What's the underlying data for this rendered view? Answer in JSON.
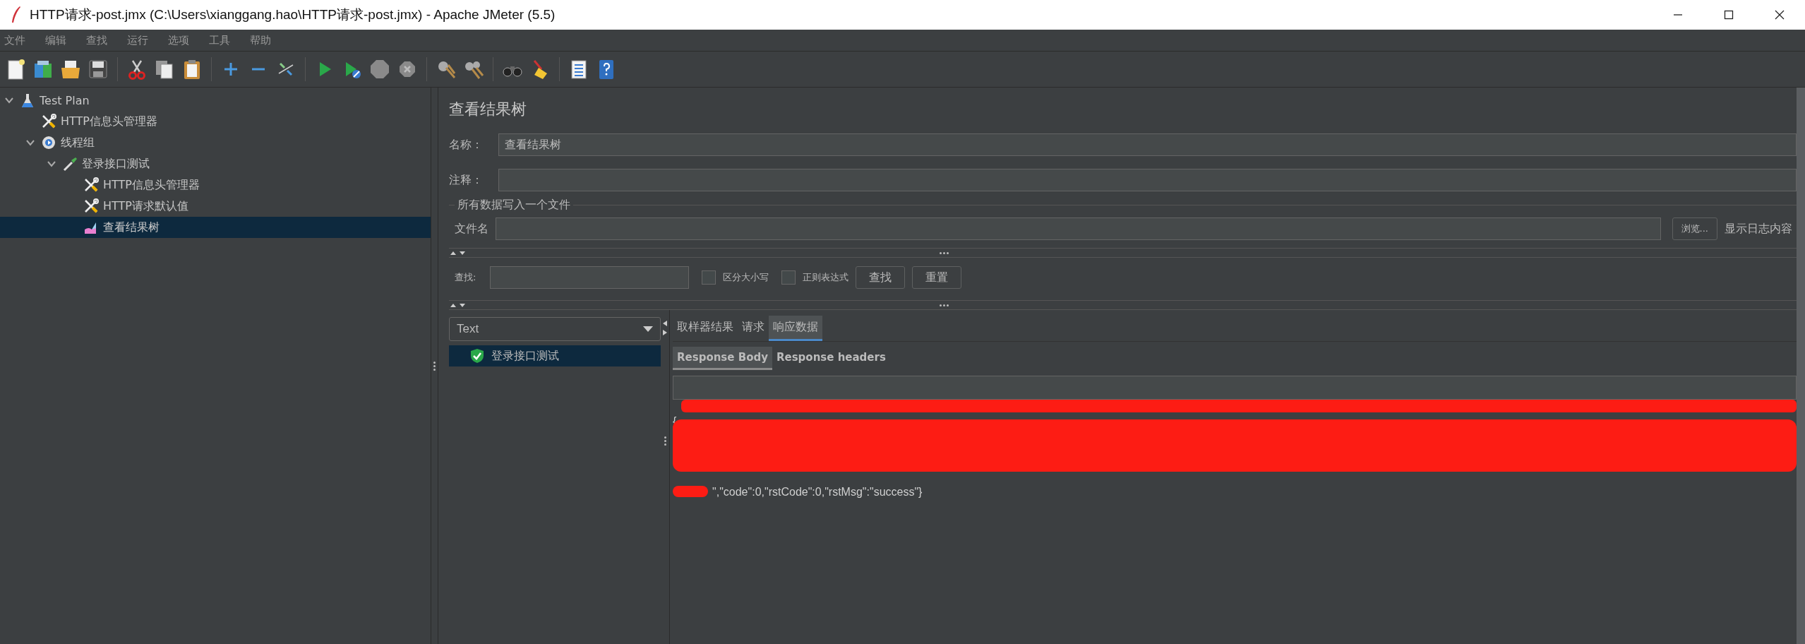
{
  "window": {
    "title": "HTTP请求-post.jmx (C:\\Users\\xianggang.hao\\HTTP请求-post.jmx) - Apache JMeter (5.5)"
  },
  "menu": [
    "文件",
    "编辑",
    "查找",
    "运行",
    "选项",
    "工具",
    "帮助"
  ],
  "tree": [
    {
      "label": "Test Plan",
      "kind": "plan",
      "expanded": true,
      "selected": false,
      "children": [
        {
          "label": "HTTP信息头管理器",
          "kind": "config",
          "selected": false
        },
        {
          "label": "线程组",
          "kind": "thread-group",
          "expanded": true,
          "selected": false,
          "children": [
            {
              "label": "登录接口测试",
              "kind": "sampler",
              "expanded": true,
              "selected": false,
              "children": [
                {
                  "label": "HTTP信息头管理器",
                  "kind": "config",
                  "selected": false
                },
                {
                  "label": "HTTP请求默认值",
                  "kind": "config",
                  "selected": false
                },
                {
                  "label": "查看结果树",
                  "kind": "listener",
                  "selected": true
                }
              ]
            }
          ]
        }
      ]
    }
  ],
  "panel": {
    "title": "查看结果树",
    "name_field": {
      "label": "名称：",
      "value": "查看结果树"
    },
    "comment_field": {
      "label": "注释："
    },
    "file_group": {
      "title": "所有数据写入一个文件",
      "label": "文件名",
      "browse_button": "浏览...",
      "log_label": "显示日志内容"
    },
    "search": {
      "label": "查找:",
      "options": [
        {
          "label": "区分大小写",
          "checked": false
        },
        {
          "label": "正则表达式",
          "checked": false
        }
      ],
      "buttons": [
        "查找",
        "重置"
      ]
    },
    "renderer": "Text",
    "results": [
      {
        "label": "登录接口测试",
        "kind": "success",
        "selected": true
      }
    ],
    "tabs": [
      {
        "label": "取样器结果",
        "selected": false
      },
      {
        "label": "请求",
        "selected": false
      },
      {
        "label": "响应数据",
        "selected": true
      }
    ],
    "subtabs": [
      {
        "label": "Response Body",
        "selected": true
      },
      {
        "label": "Response headers",
        "selected": false
      }
    ],
    "response": {
      "redacted": true,
      "lines": [
        "{",
        "\",\"code\":0,\"rstCode\":0,\"rstMsg\":\"success\"}"
      ]
    }
  }
}
